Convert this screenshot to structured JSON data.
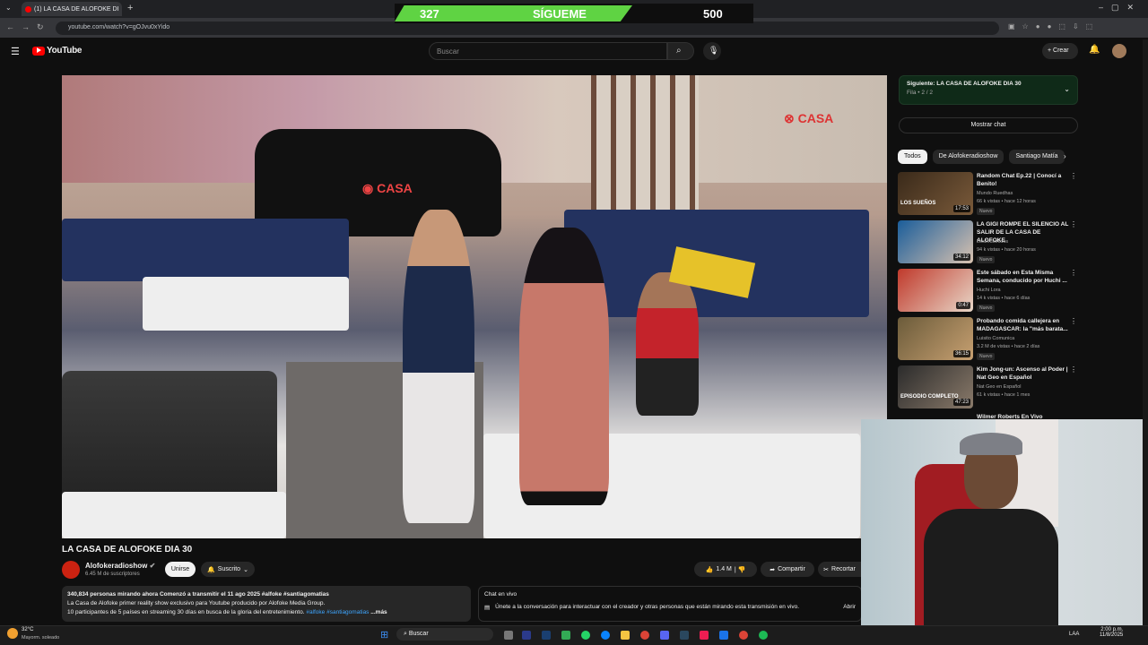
{
  "browser": {
    "tab_title": "(1) LA CASA DE ALOFOKE DI",
    "url": "youtube.com/watch?v=gOJvu0xYido"
  },
  "overlay": {
    "left_num": "327",
    "label": "SÍGUEME",
    "right_num": "500"
  },
  "youtube": {
    "logo": "YouTube",
    "search_placeholder": "Buscar",
    "create": "Crear"
  },
  "video": {
    "title": "LA CASA DE ALOFOKE DIA 30",
    "watermark": "CASA"
  },
  "channel": {
    "name": "Alofokeradioshow",
    "subs": "6.45 M de suscriptores",
    "join": "Unirse",
    "subscribed": "Suscrito"
  },
  "actions": {
    "likes": "1.4 M",
    "share": "Compartir",
    "clip": "Recortar"
  },
  "description": {
    "line1": "340,834 personas mirando ahora  Comenzó a transmitir el 11 ago 2025  #alfoke #santiagomatias",
    "line2": "La Casa de Alofoke primer reality show exclusivo para Youtube producido por Alofoke Media Group.",
    "line3": "10 participantes de 5 países en streaming 30 días en busca de la gloria del entretenimiento.",
    "tags": "#alfoke #santiagomatias",
    "more": "...más"
  },
  "live_chat": {
    "heading": "Chat en vivo",
    "text": "Únete a la conversación para interactuar con el creador y otras personas que están mirando esta transmisión en vivo.",
    "open": "Abrir"
  },
  "sidebar": {
    "next_label": "Siguiente: LA CASA DE ALOFOKE DIA 30",
    "next_sub": "Fila • 2 / 2",
    "show_chat": "Mostrar chat",
    "chips": [
      "Todos",
      "De Alofokeradioshow",
      "Santiago Matía"
    ],
    "items": [
      {
        "title": "Random Chat Ep.22 | Conocí a Benito!",
        "channel": "Mundo Ruedhas",
        "meta": "66 k vistas • hace 12 horas",
        "badge": "Nuevo",
        "duration": "17:53",
        "thumb_text": "LOS SUEÑOS",
        "c1": "#3a2a1a",
        "c2": "#7a5a3a"
      },
      {
        "title": "LA GIGI ROMPE EL SILENCIO AL SALIR DE LA CASA DE ALOFOKE",
        "channel": "LosJedionidos",
        "meta": "94 k vistas • hace 20 horas",
        "badge": "Nuevo",
        "duration": "34:12",
        "thumb_text": "",
        "c1": "#1a5d9a",
        "c2": "#d9c2b0"
      },
      {
        "title": "Este sábado en Esta Misma Semana, conducido por Huchi ...",
        "channel": "Huchi Lora",
        "meta": "14 k vistas • hace 6 días",
        "badge": "Nuevo",
        "duration": "0:47",
        "thumb_text": "",
        "c1": "#c0392b",
        "c2": "#e8d7c8"
      },
      {
        "title": "Probando comida callejera en MADAGASCAR: la \"más barata...",
        "channel": "Luisito Comunica",
        "meta": "3.2 M de vistas • hace 2 días",
        "badge": "Nuevo",
        "duration": "36:15",
        "thumb_text": "",
        "c1": "#6b5b3a",
        "c2": "#c7a071"
      },
      {
        "title": "Kim Jong-un: Ascenso al Poder | Nat Geo en Español",
        "channel": "Nat Geo en Español",
        "meta": "61 k vistas • hace 1 mes",
        "badge": "",
        "duration": "47:23",
        "thumb_text": "EPISODIO COMPLETO",
        "c1": "#2b2b2b",
        "c2": "#8a7a6a"
      }
    ],
    "partial": "Wilmer Roberts En Vivo"
  },
  "taskbar": {
    "weather_temp": "32°C",
    "weather_desc": "Mayorm. soleado",
    "search": "Buscar",
    "lang": "LAA",
    "time": "2:00 p.m.",
    "date": "11/8/2025"
  }
}
